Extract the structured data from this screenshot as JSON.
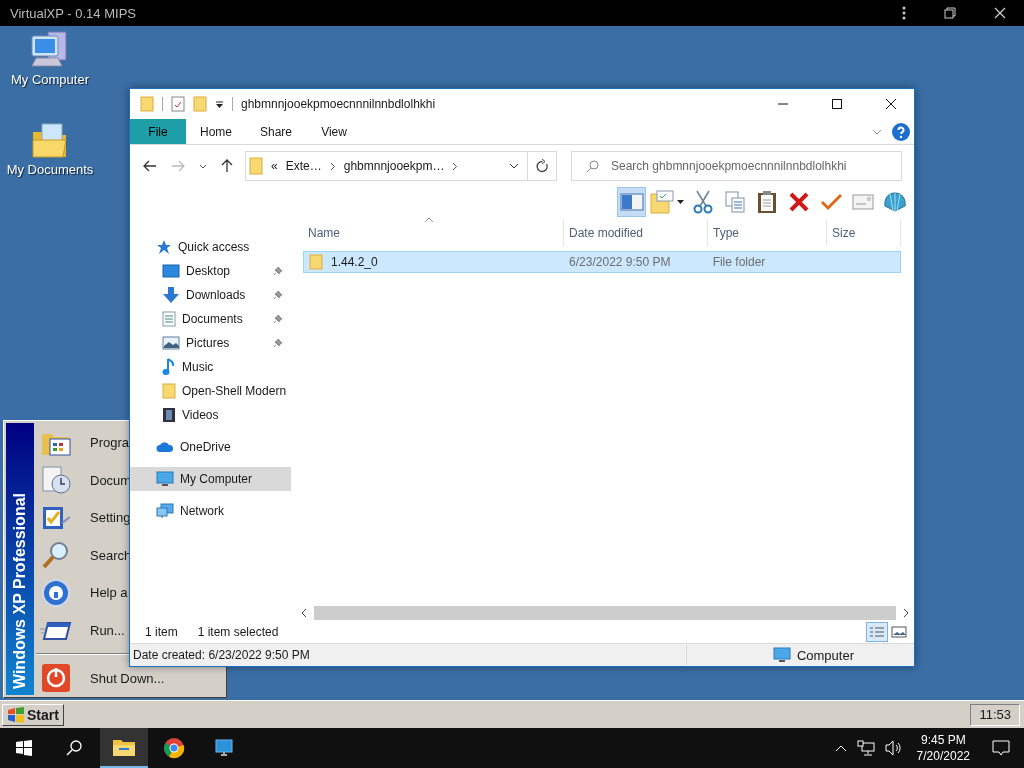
{
  "host_bar": {
    "title": "VirtualXP - 0.14 MIPS"
  },
  "desktop_icons": [
    {
      "label": "My Computer"
    },
    {
      "label": "My Documents"
    }
  ],
  "start_menu": {
    "banner": "Windows XP Professional",
    "items": [
      {
        "label": "Progra"
      },
      {
        "label": "Docum"
      },
      {
        "label": "Setting"
      },
      {
        "label": "Search"
      },
      {
        "label": "Help a"
      },
      {
        "label": "Run..."
      }
    ],
    "shutdown": "Shut Down..."
  },
  "explorer": {
    "title": "ghbmnnjooekpmoecnnnilnnbdlolhkhi",
    "ribbon_tabs": [
      {
        "label": "File",
        "selected": true
      },
      {
        "label": "Home",
        "selected": false
      },
      {
        "label": "Share",
        "selected": false
      },
      {
        "label": "View",
        "selected": false
      }
    ],
    "address": {
      "overflow": "«",
      "crumbs": [
        "Exte…",
        "ghbmnnjooekpm…"
      ]
    },
    "search": {
      "placeholder": "Search ghbmnnjooekpmoecnnnilnnbdlolhkhi"
    },
    "toolbar": {
      "preview_pane": {
        "selected": true
      }
    },
    "nav": [
      {
        "label": "Quick access",
        "selected": false,
        "children": [
          {
            "label": "Desktop",
            "pinned": true,
            "selected": false
          },
          {
            "label": "Downloads",
            "pinned": true,
            "selected": false
          },
          {
            "label": "Documents",
            "pinned": true,
            "selected": false
          },
          {
            "label": "Pictures",
            "pinned": true,
            "selected": false
          },
          {
            "label": "Music",
            "pinned": false,
            "selected": false
          },
          {
            "label": "Open-Shell Modern",
            "pinned": false,
            "selected": false
          },
          {
            "label": "Videos",
            "pinned": false,
            "selected": false
          }
        ]
      },
      {
        "label": "OneDrive",
        "selected": false
      },
      {
        "label": "My Computer",
        "selected": true
      },
      {
        "label": "Network",
        "selected": false
      }
    ],
    "columns": [
      {
        "label": "Name",
        "sorted": true
      },
      {
        "label": "Date modified",
        "sorted": false
      },
      {
        "label": "Type",
        "sorted": false
      },
      {
        "label": "Size",
        "sorted": false
      }
    ],
    "rows": [
      {
        "name": "1.44.2_0",
        "date_modified": "6/23/2022 9:50 PM",
        "type": "File folder",
        "selected": true
      }
    ],
    "status": {
      "item_count": "1 item",
      "selection": "1 item selected",
      "view_buttons": [
        {
          "selected": true
        },
        {
          "selected": false
        }
      ]
    },
    "details_bar": {
      "info": "Date created: 6/23/2022 9:50 PM",
      "location": "Computer"
    }
  },
  "xp_taskbar": {
    "start": "Start",
    "clock": "11:53"
  },
  "taskbar": {
    "apps": [
      {
        "selected": true
      },
      {
        "selected": false
      },
      {
        "selected": false
      }
    ],
    "time": "9:45 PM",
    "date": "7/20/2022"
  }
}
